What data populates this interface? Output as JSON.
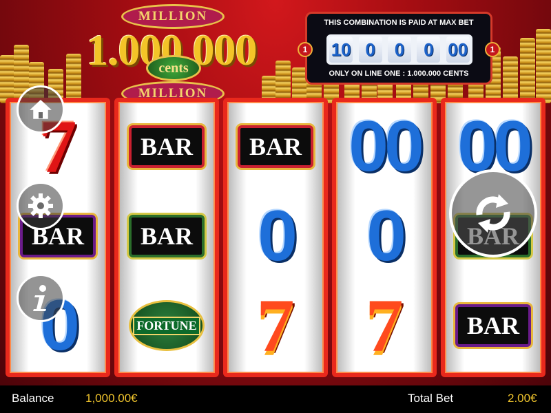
{
  "logo": {
    "million_top": "MILLION",
    "big_number": "1.000.000",
    "cents": "cents",
    "million_bottom": "MILLION"
  },
  "paytable": {
    "title": "THIS COMBINATION IS PAID AT MAX BET",
    "cells": [
      "10",
      "0",
      "0",
      "0",
      "00"
    ],
    "line_marker": "1",
    "footer": "ONLY ON LINE ONE : 1.000.000 CENTS"
  },
  "reels": [
    {
      "symbols": [
        {
          "type": "seven",
          "label": "7"
        },
        {
          "type": "bar",
          "label": "BAR",
          "variant": "purple"
        },
        {
          "type": "zero",
          "label": "0"
        }
      ]
    },
    {
      "symbols": [
        {
          "type": "bar",
          "label": "BAR"
        },
        {
          "type": "bar",
          "label": "BAR",
          "variant": "green"
        },
        {
          "type": "fortune",
          "label": "FORTUNE"
        }
      ]
    },
    {
      "symbols": [
        {
          "type": "bar",
          "label": "BAR"
        },
        {
          "type": "zero",
          "label": "0"
        },
        {
          "type": "seven",
          "label": "7",
          "variant": "fire"
        }
      ]
    },
    {
      "symbols": [
        {
          "type": "zero",
          "label": "00"
        },
        {
          "type": "zero",
          "label": "0"
        },
        {
          "type": "seven",
          "label": "7",
          "variant": "fire"
        }
      ]
    },
    {
      "symbols": [
        {
          "type": "zero",
          "label": "00"
        },
        {
          "type": "bar",
          "label": "BAR",
          "variant": "green"
        },
        {
          "type": "bar",
          "label": "BAR",
          "variant": "purple"
        }
      ]
    }
  ],
  "buttons": {
    "home_icon": "home-icon",
    "settings_icon": "gear-icon",
    "info_icon": "info-icon",
    "spin_icon": "refresh-icon"
  },
  "footer": {
    "balance_label": "Balance",
    "balance_value": "1,000.00€",
    "total_bet_label": "Total Bet",
    "total_bet_value": "2.00€"
  },
  "colors": {
    "accent_gold": "#f2c62d",
    "reel_border": "#e9291c",
    "background_red": "#a50d12"
  }
}
